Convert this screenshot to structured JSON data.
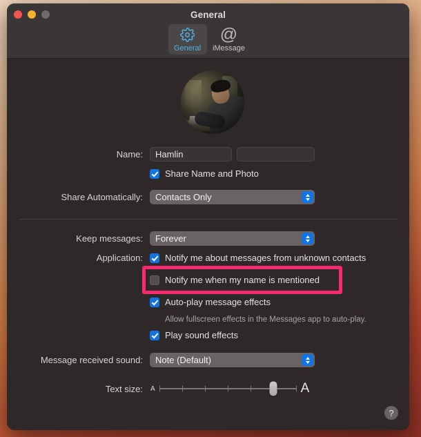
{
  "window": {
    "title": "General",
    "traffic_lights": [
      "close-button",
      "minimize-button",
      "zoom-button"
    ]
  },
  "toolbar": {
    "tabs": [
      {
        "label": "General",
        "icon": "gear-icon",
        "selected": true
      },
      {
        "label": "iMessage",
        "icon": "at-icon",
        "selected": false
      }
    ]
  },
  "profile": {
    "avatar_alt": "user-avatar-photo"
  },
  "form": {
    "name_label": "Name:",
    "first_name_value": "Hamlin",
    "last_name_value": "",
    "last_name_placeholder": "",
    "share_name_and_photo": {
      "label": "Share Name and Photo",
      "checked": true
    },
    "share_automatically_label": "Share Automatically:",
    "share_automatically_value": "Contacts Only",
    "keep_messages_label": "Keep messages:",
    "keep_messages_value": "Forever",
    "application_label": "Application:",
    "notify_unknown_contacts": {
      "label": "Notify me about messages from unknown contacts",
      "checked": true
    },
    "notify_name_mentioned": {
      "label": "Notify me when my name is mentioned",
      "checked": false
    },
    "auto_play_effects": {
      "label": "Auto-play message effects",
      "checked": true,
      "description": "Allow fullscreen effects in the Messages app to auto-play."
    },
    "play_sound_effects": {
      "label": "Play sound effects",
      "checked": true
    },
    "message_received_sound_label": "Message received sound:",
    "message_received_sound_value": "Note (Default)",
    "text_size_label": "Text size:",
    "text_size_min_glyph": "A",
    "text_size_max_glyph": "A",
    "text_size_ticks": 7,
    "text_size_position": 6
  },
  "help_button": {
    "glyph": "?"
  },
  "annotation": {
    "color": "#f72a6d",
    "target": "notify-name-mentioned-checkbox"
  }
}
